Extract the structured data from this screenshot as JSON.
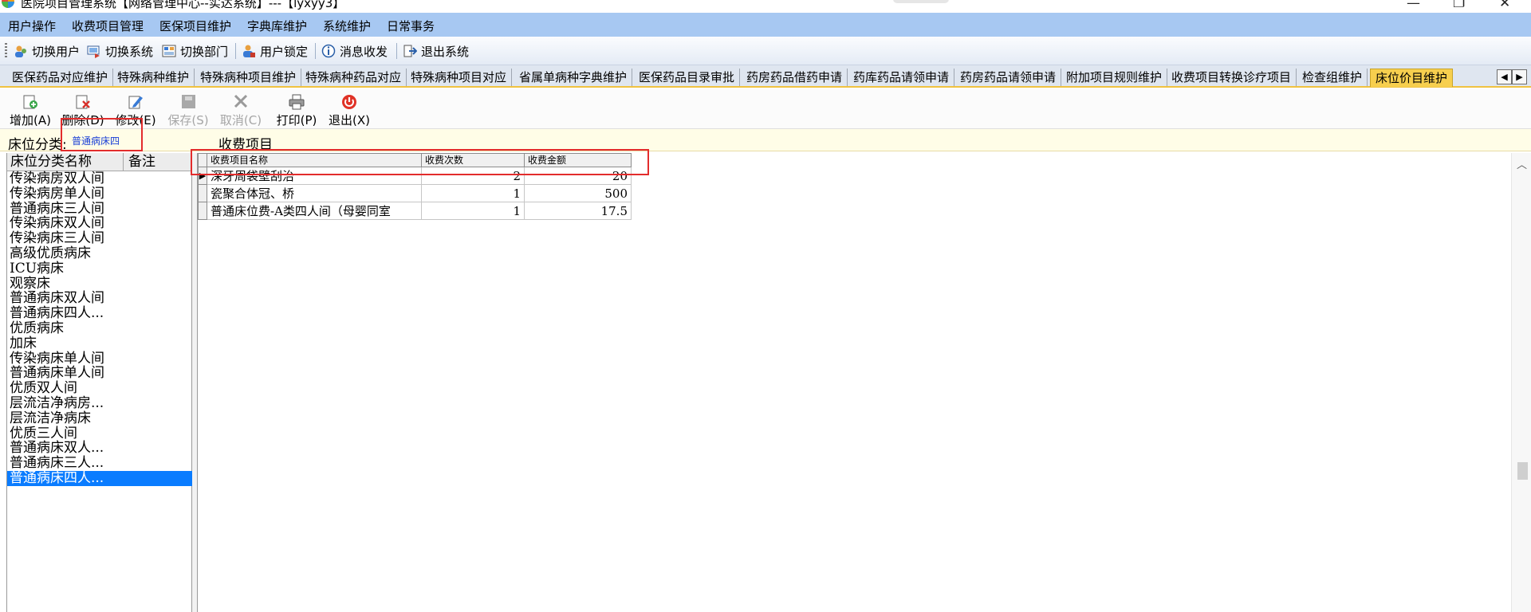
{
  "window": {
    "title": "医院项目管理系统【网络管理中心--实达系统】---【lyxyy3】",
    "controls": [
      "—",
      "❐",
      "✕"
    ]
  },
  "menu": [
    "用户操作",
    "收费项目管理",
    "医保项目维护",
    "字典库维护",
    "系统维护",
    "日常事务"
  ],
  "toolbar": [
    {
      "label": "切换用户",
      "icon": "switch-user-icon"
    },
    {
      "label": "切换系统",
      "icon": "switch-system-icon"
    },
    {
      "label": "切换部门",
      "icon": "switch-department-icon"
    },
    {
      "label": "用户锁定",
      "icon": "user-lock-icon"
    },
    {
      "label": "消息收发",
      "icon": "message-icon"
    },
    {
      "label": "退出系统",
      "icon": "exit-system-icon"
    }
  ],
  "tabs": [
    "医保药品对应维护",
    "特殊病种维护",
    "特殊病种项目维护",
    "特殊病种药品对应",
    "特殊病种项目对应",
    "省属单病种字典维护",
    "医保药品目录审批",
    "药房药品借药申请",
    "药库药品请领申请",
    "药房药品请领申请",
    "附加项目规则维护",
    "收费项目转换诊疗项目",
    "检查组维护",
    "床位价目维护"
  ],
  "tab_scroll": {
    "left": "◀",
    "right": "▶"
  },
  "actions": [
    {
      "label": "增加(A)",
      "icon": "add-icon",
      "enabled": true
    },
    {
      "label": "删除(D)",
      "icon": "delete-icon",
      "enabled": true
    },
    {
      "label": "修改(E)",
      "icon": "edit-icon",
      "enabled": true
    },
    {
      "label": "保存(S)",
      "icon": "save-icon",
      "enabled": false
    },
    {
      "label": "取消(C)",
      "icon": "cancel-icon",
      "enabled": false
    },
    {
      "label": "打印(P)",
      "icon": "print-icon",
      "enabled": true
    },
    {
      "label": "退出(X)",
      "icon": "exit-icon",
      "enabled": true
    }
  ],
  "info": {
    "bed_category_label": "床位分类:",
    "bed_category_value": "普通病床四",
    "charge_items_label": "收费项目"
  },
  "left_list": {
    "headers": [
      "床位分类名称",
      "备注"
    ],
    "items": [
      "传染病房双人间",
      "传染病房单人间",
      "普通病床三人间",
      "传染病床双人间",
      "传染病床三人间",
      "高级优质病床",
      "ICU病床",
      "观察床",
      "普通病床双人间",
      "普通病床四人...",
      "优质病床",
      "加床",
      "传染病床单人间",
      "普通病床单人间",
      "优质双人间",
      "层流洁净病房...",
      "层流洁净病床",
      "优质三人间",
      "普通病床双人...",
      "普通病床三人...",
      "普通病床四人..."
    ],
    "selected_index": 20
  },
  "grid": {
    "headers": [
      "收费项目名称",
      "收费次数",
      "收费金额"
    ],
    "rows": [
      {
        "name": "深牙周袋壁刮治",
        "count": "2",
        "amount": "20",
        "current": true
      },
      {
        "name": "瓷聚合体冠、桥",
        "count": "1",
        "amount": "500",
        "current": false
      },
      {
        "name": "普通床位费-A类四人间（母婴同室",
        "count": "1",
        "amount": "17.5",
        "current": false
      }
    ]
  },
  "colors": {
    "menu_bg": "#a7c8f2",
    "active_tab": "#f7cf4e",
    "selection": "#0a7cff",
    "highlight_box": "#e32c2c",
    "info_bg": "#fffde7"
  }
}
